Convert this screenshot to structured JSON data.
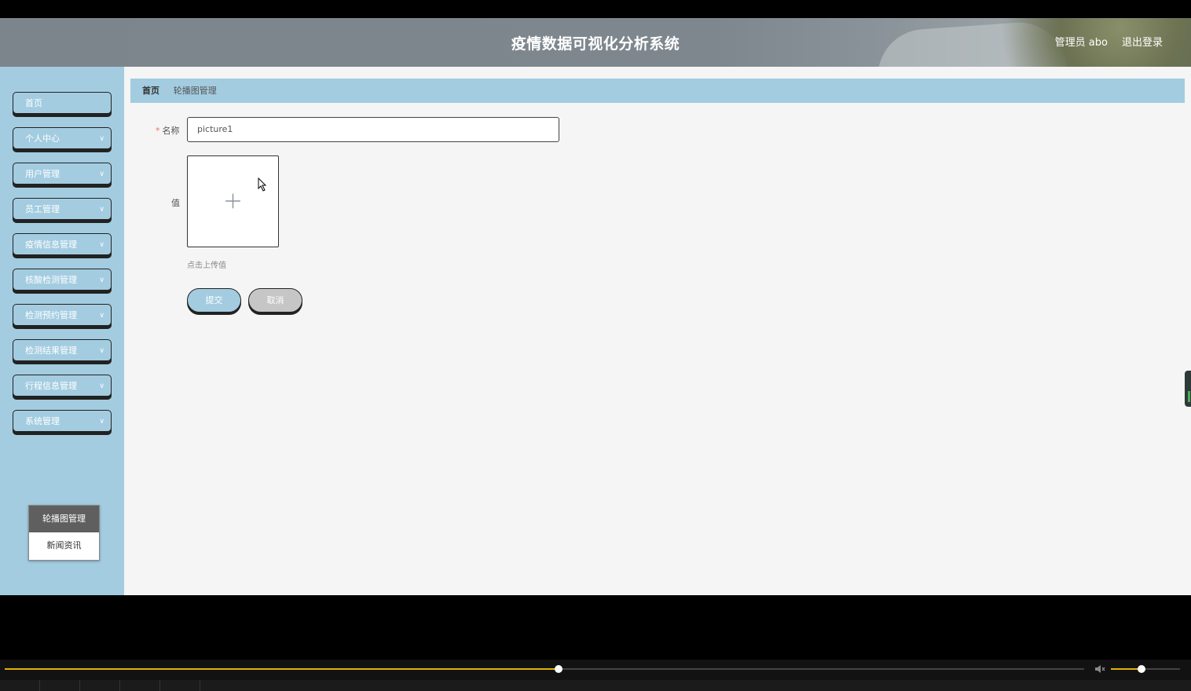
{
  "header": {
    "title": "疫情数据可视化分析系统",
    "user_label": "管理员 abo",
    "logout_label": "退出登录"
  },
  "sidebar": {
    "items": [
      {
        "label": "首页",
        "has_chevron": false
      },
      {
        "label": "个人中心",
        "has_chevron": true
      },
      {
        "label": "用户管理",
        "has_chevron": true
      },
      {
        "label": "员工管理",
        "has_chevron": true
      },
      {
        "label": "疫情信息管理",
        "has_chevron": true
      },
      {
        "label": "核酸检测管理",
        "has_chevron": true
      },
      {
        "label": "检测预约管理",
        "has_chevron": true
      },
      {
        "label": "检测结果管理",
        "has_chevron": true
      },
      {
        "label": "行程信息管理",
        "has_chevron": true
      },
      {
        "label": "系统管理",
        "has_chevron": true
      }
    ],
    "submenu": [
      {
        "label": "轮播图管理",
        "active": true
      },
      {
        "label": "新闻资讯",
        "active": false
      }
    ]
  },
  "breadcrumb": {
    "home": "首页",
    "current": "轮播图管理"
  },
  "form": {
    "name_label": "名称",
    "name_value": "picture1",
    "value_label": "值",
    "upload_hint": "点击上传值",
    "submit_label": "提交",
    "cancel_label": "取消"
  },
  "player": {
    "progress": 0.513,
    "volume": 0.44
  },
  "colors": {
    "sidebar_bg": "#a3cce0",
    "accent": "#e2b300",
    "required": "#f56c6c"
  }
}
